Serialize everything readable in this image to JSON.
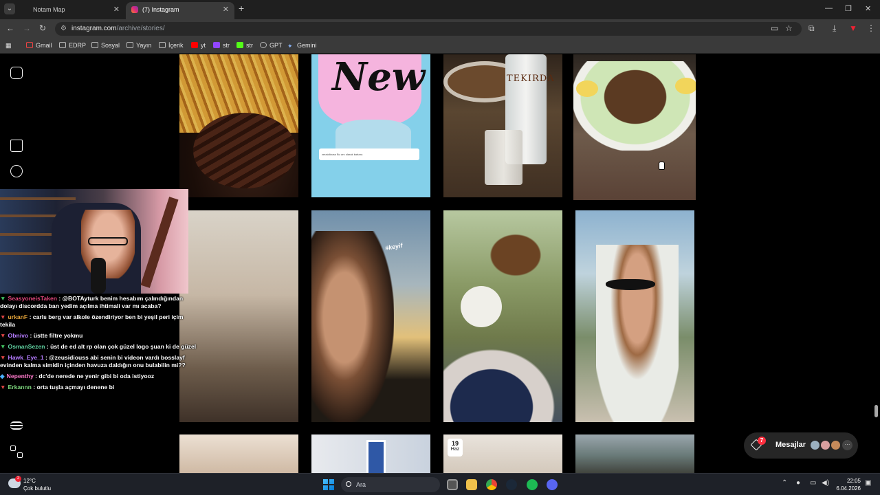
{
  "browser": {
    "tabs": [
      {
        "label": "Notam Map",
        "active": false
      },
      {
        "label": "(7) Instagram",
        "active": true
      }
    ],
    "url_host": "instagram.com",
    "url_path": "/archive/stories/",
    "bookmarks": [
      {
        "label": "Gmail",
        "icon": "gmail-icon"
      },
      {
        "label": "EDRP",
        "icon": "folder-icon"
      },
      {
        "label": "Sosyal",
        "icon": "folder-icon"
      },
      {
        "label": "Yayın",
        "icon": "folder-icon"
      },
      {
        "label": "İçerik",
        "icon": "folder-icon"
      },
      {
        "label": "yt",
        "icon": "youtube-icon"
      },
      {
        "label": "str",
        "icon": "twitch-icon"
      },
      {
        "label": "str",
        "icon": "kick-icon"
      },
      {
        "label": "GPT",
        "icon": "chatgpt-icon"
      },
      {
        "label": "Gemini",
        "icon": "gemini-icon"
      }
    ]
  },
  "instagram": {
    "stories": {
      "new_sticker": "New",
      "reply_text": "zeusidiouss Bu anı olarak kalsına",
      "tekirdag_label": "TEKIRDA",
      "keyif_tag": "#keyif",
      "date_day": "19",
      "date_month": "Haz"
    },
    "messages": {
      "label": "Mesajlar",
      "badge": "7"
    }
  },
  "chat": [
    {
      "user": "SeasyoneisTaken",
      "text": ": @BOTAyturk benim hesabım çalındığından",
      "cont": "dolayı discordda ban yedim açılma ihtimali var mı acaba?",
      "color": "#e0457b",
      "chev": "green"
    },
    {
      "user": "urkanF",
      "text": ": carls berg var alkole özendiriyor ben bi yeşil peri içim",
      "cont": "tekila",
      "color": "#e6a53a",
      "chev": "red"
    },
    {
      "user": "Obnivo",
      "text": ": üstte filtre yokmu",
      "cont": "",
      "color": "#b57bff",
      "chev": "red"
    },
    {
      "user": "OsmanSezen",
      "text": ": üst de ed alt rp olan çok güzel logo şuan ki de güzel",
      "cont": "",
      "color": "#5fd0a0",
      "chev": "green"
    },
    {
      "user": "Hawk_Eye_1",
      "text": ": @zeusidiouss abi senin bi videon vardı bosslayf",
      "cont": "evinden kalma simidin içinden havuza daldığın onu bulabilin mi??",
      "color": "#b57bff",
      "chev": "red"
    },
    {
      "user": "Nepenthy",
      "text": ": dc'de nerede ne yenir gibi bi oda istiyooz",
      "cont": "",
      "color": "#ff7acc",
      "chev": "none"
    },
    {
      "user": "Erkannn",
      "text": ": orta tuşla açmayı denene bi",
      "cont": "",
      "color": "#7cd67c",
      "chev": "red"
    }
  ],
  "taskbar": {
    "temperature": "12°C",
    "weather": "Çok bulutlu",
    "weather_badge": "2",
    "search_placeholder": "Ara",
    "time": "22:05",
    "date": "6.04.2026"
  }
}
